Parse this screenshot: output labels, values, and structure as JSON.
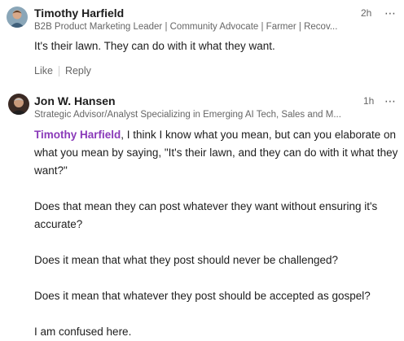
{
  "comments": [
    {
      "author": "Timothy Harfield",
      "headline": "B2B Product Marketing Leader | Community Advocate | Farmer | Recov...",
      "time": "2h",
      "text": "It's their lawn. They can do with it what they want.",
      "actions": {
        "like": "Like",
        "reply": "Reply"
      }
    },
    {
      "author": "Jon W. Hansen",
      "headline": "Strategic Advisor/Analyst Specializing in Emerging AI Tech, Sales and M...",
      "time": "1h",
      "mention": "Timothy Harfield",
      "paragraphs": [
        ", I think I know what you mean, but can you elaborate on what you mean by saying, \"It's their lawn, and they can do with it what they want?\"",
        "Does that mean they can post whatever they want without ensuring it's accurate?",
        "Does it mean that what they post should never be challenged?",
        "Does it mean that whatever they post should be accepted as gospel?",
        "I am confused here."
      ]
    }
  ],
  "icons": {
    "more": "more-options-icon"
  },
  "colors": {
    "mention": "#8a3ab9",
    "secondary_text": "#666666"
  }
}
